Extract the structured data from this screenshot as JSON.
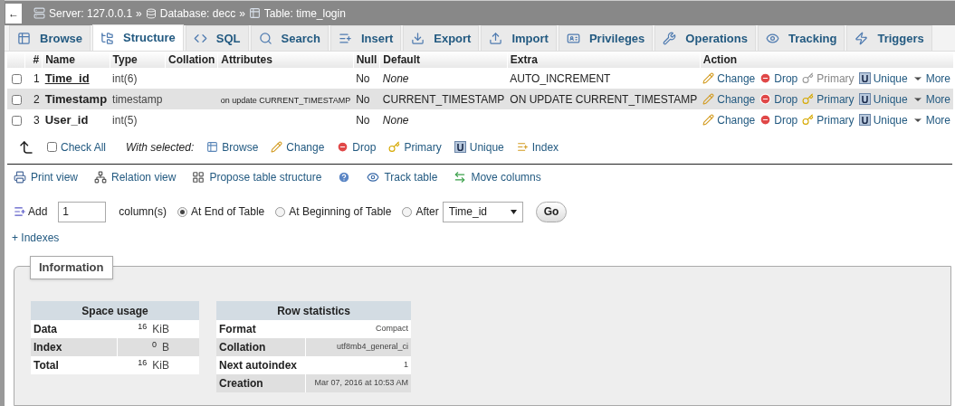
{
  "breadcrumb": {
    "back": "←",
    "items": [
      {
        "kind": "server",
        "label": "Server: 127.0.0.1"
      },
      {
        "kind": "database",
        "label": "Database: decc"
      },
      {
        "kind": "table",
        "label": "Table: time_login"
      }
    ],
    "separator": "»"
  },
  "tabs": [
    {
      "label": "Browse",
      "kind": "browse",
      "selected": false
    },
    {
      "label": "Structure",
      "kind": "structure",
      "selected": true
    },
    {
      "label": "SQL",
      "kind": "sql",
      "selected": false
    },
    {
      "label": "Search",
      "kind": "search",
      "selected": false
    },
    {
      "label": "Insert",
      "kind": "insert",
      "selected": false
    },
    {
      "label": "Export",
      "kind": "export",
      "selected": false
    },
    {
      "label": "Import",
      "kind": "import",
      "selected": false
    },
    {
      "label": "Privileges",
      "kind": "privileges",
      "selected": false
    },
    {
      "label": "Operations",
      "kind": "operations",
      "selected": false
    },
    {
      "label": "Tracking",
      "kind": "tracking",
      "selected": false
    },
    {
      "label": "Triggers",
      "kind": "triggers",
      "selected": false
    }
  ],
  "table": {
    "columns": [
      "#",
      "Name",
      "Type",
      "Collation",
      "Attributes",
      "Null",
      "Default",
      "Extra",
      "Action"
    ],
    "rows": [
      {
        "checked": false,
        "num": "1",
        "name": "Time_id",
        "primary_key": true,
        "type": "int(6)",
        "null": "No",
        "default": "None",
        "default_none": true,
        "extra": "AUTO_INCREMENT",
        "actions": [
          {
            "kind": "change",
            "label": "Change",
            "disabled": false
          },
          {
            "kind": "drop",
            "label": "Drop",
            "disabled": false
          },
          {
            "kind": "primary",
            "label": "Primary",
            "disabled": true
          },
          {
            "kind": "unique",
            "label": "Unique",
            "disabled": false
          },
          {
            "kind": "more",
            "label": "More",
            "disabled": false
          }
        ]
      },
      {
        "checked": false,
        "num": "2",
        "name": "Timestamp",
        "primary_key": false,
        "type": "timestamp",
        "attributes": "on update CURRENT_TIMESTAMP",
        "null": "No",
        "default": "CURRENT_TIMESTAMP",
        "default_none": false,
        "extra": "ON UPDATE CURRENT_TIMESTAMP",
        "actions": [
          {
            "kind": "change",
            "label": "Change",
            "disabled": false
          },
          {
            "kind": "drop",
            "label": "Drop",
            "disabled": false
          },
          {
            "kind": "primary",
            "label": "Primary",
            "disabled": false
          },
          {
            "kind": "unique",
            "label": "Unique",
            "disabled": false
          },
          {
            "kind": "more",
            "label": "More",
            "disabled": false
          }
        ]
      },
      {
        "checked": false,
        "num": "3",
        "name": "User_id",
        "primary_key": false,
        "type": "int(5)",
        "null": "No",
        "default": "None",
        "default_none": true,
        "actions": [
          {
            "kind": "change",
            "label": "Change",
            "disabled": false
          },
          {
            "kind": "drop",
            "label": "Drop",
            "disabled": false
          },
          {
            "kind": "primary",
            "label": "Primary",
            "disabled": false
          },
          {
            "kind": "unique",
            "label": "Unique",
            "disabled": false
          },
          {
            "kind": "more",
            "label": "More",
            "disabled": false
          }
        ]
      }
    ]
  },
  "bulk": {
    "check_all": {
      "label": "Check All",
      "checked": false
    },
    "with_selected": "With selected:",
    "actions": [
      {
        "kind": "browse",
        "label": "Browse"
      },
      {
        "kind": "change",
        "label": "Change"
      },
      {
        "kind": "drop",
        "label": "Drop"
      },
      {
        "kind": "primary",
        "label": "Primary"
      },
      {
        "kind": "unique",
        "label": "Unique"
      },
      {
        "kind": "index",
        "label": "Index"
      }
    ]
  },
  "links": [
    {
      "kind": "print",
      "label": "Print view"
    },
    {
      "kind": "relation",
      "label": "Relation view"
    },
    {
      "kind": "propose",
      "label": "Propose table structure"
    },
    {
      "kind": "help"
    },
    {
      "kind": "track",
      "label": "Track table"
    },
    {
      "kind": "move",
      "label": "Move columns"
    }
  ],
  "add_columns": {
    "label": "Add",
    "count": "1",
    "unit": "column(s)",
    "positions": [
      {
        "label": "At End of Table",
        "selected": true
      },
      {
        "label": "At Beginning of Table",
        "selected": false
      },
      {
        "label": "After",
        "selected": false
      }
    ],
    "after_column": "Time_id",
    "go": "Go"
  },
  "indexes": "+ Indexes",
  "information": {
    "legend": "Information",
    "space_usage": {
      "title": "Space usage",
      "rows": [
        {
          "label": "Data",
          "value": "16",
          "unit": "KiB"
        },
        {
          "label": "Index",
          "value": "0",
          "unit": "B"
        },
        {
          "label": "Total",
          "value": "16",
          "unit": "KiB"
        }
      ]
    },
    "row_statistics": {
      "title": "Row statistics",
      "rows": [
        {
          "label": "Format",
          "value": "Compact"
        },
        {
          "label": "Collation",
          "value": "utf8mb4_general_ci"
        },
        {
          "label": "Next autoindex",
          "value": "1"
        },
        {
          "label": "Creation",
          "value": "Mar 07, 2016 at 10:53 AM"
        }
      ]
    }
  }
}
